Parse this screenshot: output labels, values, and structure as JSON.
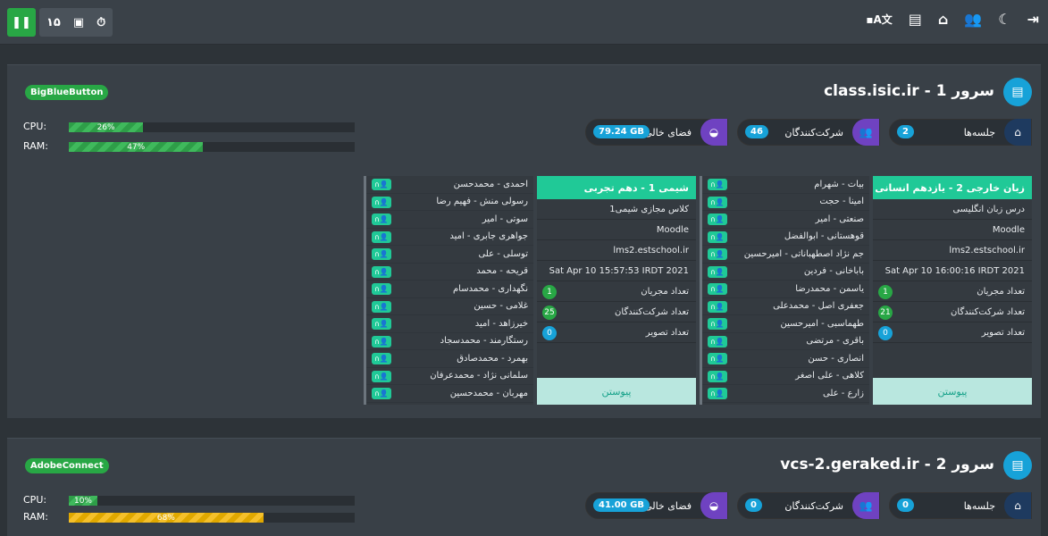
{
  "topbar": {
    "left_count": "۱۵",
    "right_icons": [
      "language-icon",
      "document-icon",
      "store-icon",
      "users-icon",
      "moon-icon",
      "logout-icon"
    ]
  },
  "servers": [
    {
      "badge": "BigBlueButton",
      "title": "class.isic.ir - سرور 1",
      "cpu_label": "CPU:",
      "ram_label": "RAM:",
      "cpu": "26%",
      "ram": "47%",
      "cpu_pct": 26,
      "ram_pct": 47,
      "stats": [
        {
          "label": "جلسه‌ها",
          "value": "2"
        },
        {
          "label": "شرکت‌کنندگان",
          "value": "46"
        },
        {
          "label": "فضای خالی",
          "value": "79.24 GB"
        }
      ],
      "rooms": [
        {
          "title": "زبان خارجی 2 - یازدهم انسانی",
          "name": "درس زبان انگلیسی",
          "platform": "Moodle",
          "host": "lms2.estschool.ir",
          "date": "Sat Apr 10 16:00:16 IRDT 2021",
          "mod_label": "تعداد مجریان",
          "mod": "1",
          "part_label": "تعداد شرکت‌کنندگان",
          "part": "21",
          "vid_label": "تعداد تصویر",
          "vid": "0",
          "join": "پیوستن",
          "users": [
            "بیات - شهرام",
            "امینا - حجت",
            "صنعتی - امیر",
            "قوهستانی - ابوالفضل",
            "جم نژاد اصطهباناتی - امیرحسین",
            "باباخانی - فردین",
            "یاسمن - محمدرضا",
            "جعفری اصل - محمدعلی",
            "طهماسبی - امیرحسین",
            "باقری - مرتضی",
            "انصاری - حسن",
            "کلاهی - علی اصغر",
            "زارع - علی"
          ]
        },
        {
          "title": "شیمی 1 - دهم تجربی",
          "name": "کلاس مجازی شیمی1",
          "platform": "Moodle",
          "host": "lms2.estschool.ir",
          "date": "Sat Apr 10 15:57:53 IRDT 2021",
          "mod_label": "تعداد مجریان",
          "mod": "1",
          "part_label": "تعداد شرکت‌کنندگان",
          "part": "25",
          "vid_label": "تعداد تصویر",
          "vid": "0",
          "join": "پیوستن",
          "users": [
            "احمدی - محمدحسن",
            "رسولی منش - فهیم رضا",
            "سوتی - امیر",
            "جواهری جابری - امید",
            "توسلی - علی",
            "قریحه - محمد",
            "نگهداری - محمدسام",
            "غلامی - حسین",
            "خیرزاهد - امید",
            "رستگارمند - محمدسجاد",
            "بهمرد - محمدصادق",
            "سلمانی نژاد - محمدعرفان",
            "مهربان - محمدحسین"
          ]
        }
      ]
    },
    {
      "badge": "AdobeConnect",
      "title": "vcs-2.geraked.ir - سرور 2",
      "cpu_label": "CPU:",
      "ram_label": "RAM:",
      "cpu": "10%",
      "ram": "68%",
      "cpu_pct": 10,
      "ram_pct": 68,
      "stats": [
        {
          "label": "جلسه‌ها",
          "value": "0"
        },
        {
          "label": "شرکت‌کنندگان",
          "value": "0"
        },
        {
          "label": "فضای خالی",
          "value": "41.00 GB"
        }
      ]
    }
  ]
}
